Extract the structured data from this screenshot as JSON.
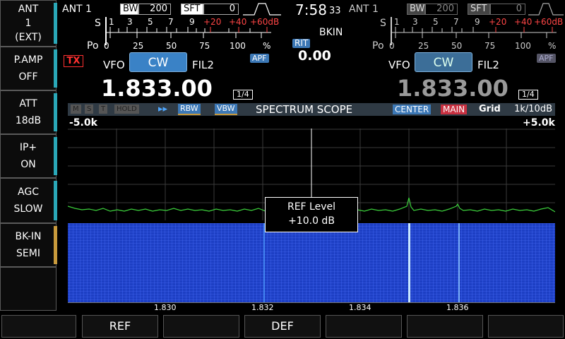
{
  "sidebar": {
    "items": [
      {
        "line1": "ANT",
        "line2": "1",
        "line3": "(EXT)"
      },
      {
        "line1": "P.AMP",
        "line2": "OFF"
      },
      {
        "line1": "ATT",
        "line2": "18dB"
      },
      {
        "line1": "IP+",
        "line2": "ON"
      },
      {
        "line1": "AGC",
        "line2": "SLOW"
      },
      {
        "line1": "BK-IN",
        "line2": "SEMI"
      }
    ]
  },
  "main": {
    "ant": "ANT 1",
    "bw_tag": "BW",
    "bw_value": "200",
    "sft_tag": "SFT",
    "sft_value": "0",
    "meter": {
      "s_label": "S",
      "po_label": "Po",
      "s_scale": [
        "1",
        "3",
        "5",
        "7",
        "9"
      ],
      "s_scale_red": [
        "+20",
        "+40",
        "+60dB"
      ],
      "po_scale": [
        "0",
        "25",
        "50",
        "75",
        "100",
        "%"
      ]
    },
    "tx": "TX",
    "apf": "APF",
    "vfo": "VFO",
    "mode": "CW",
    "filter": "FIL2",
    "frequency": "1.833.00",
    "tuning_step": "1/4"
  },
  "center": {
    "clock_hm": "7:58",
    "clock_s": "33",
    "bkin": "BKIN",
    "rit_tag": "RIT",
    "rit_value": "0.00"
  },
  "sub": {
    "ant": "ANT 1",
    "bw_tag": "BW",
    "bw_value": "200",
    "sft_tag": "SFT",
    "sft_value": "0",
    "meter": {
      "s_label": "S",
      "po_label": "Po",
      "s_scale": [
        "1",
        "3",
        "5",
        "7",
        "9"
      ],
      "s_scale_red": [
        "+20",
        "+40",
        "+60dB"
      ],
      "po_scale": [
        "0",
        "25",
        "50",
        "75",
        "100",
        "%"
      ]
    },
    "apf": "APF",
    "vfo": "VFO",
    "mode": "CW",
    "filter": "FIL2",
    "frequency": "1.833.00",
    "tuning_step": "1/4"
  },
  "scope": {
    "indicators": [
      "M",
      "S",
      "T",
      "HOLD"
    ],
    "play": "▸▸",
    "rbw": "RBW",
    "vbw": "VBW",
    "title": "SPECTRUM SCOPE",
    "center": "CENTER",
    "main": "MAIN",
    "grid": "Grid",
    "span": "1k/10dB",
    "span_left": "-5.0k",
    "span_right": "+5.0k",
    "freq_ticks": [
      "1.830",
      "1.832",
      "1.834",
      "1.836"
    ],
    "popup_line1": "REF Level",
    "popup_line2": "+10.0 dB"
  },
  "footer": {
    "buttons": [
      "",
      "REF",
      "",
      "DEF",
      "",
      "",
      ""
    ]
  },
  "colors": {
    "spectrum_trace": "#3cd03c",
    "waterfall": "#1d3fc4",
    "accent": "#3a82c6",
    "tx_red": "#ff3030"
  }
}
